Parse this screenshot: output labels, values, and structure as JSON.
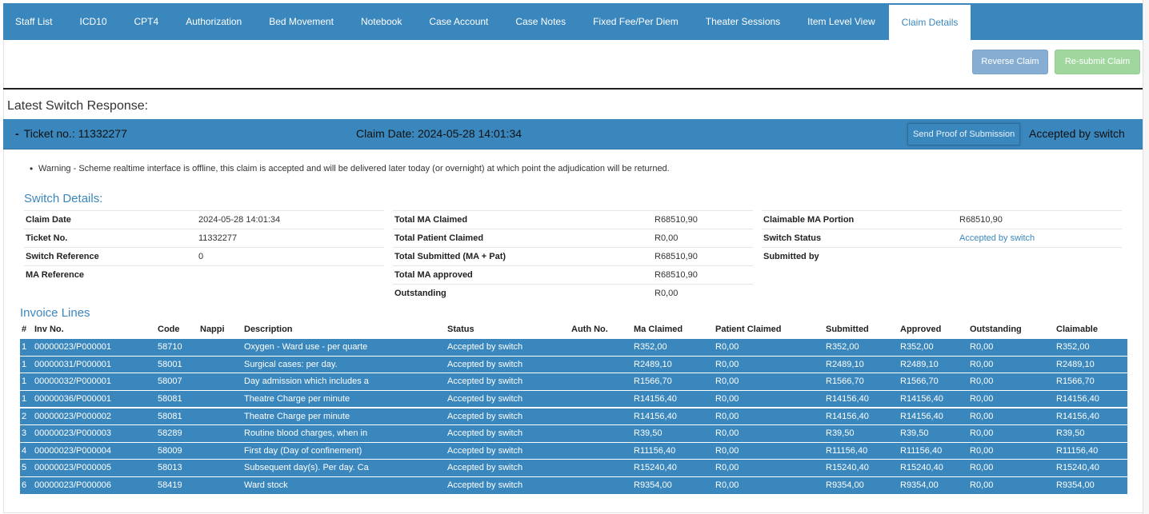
{
  "tabs": [
    {
      "label": "Staff List",
      "active": false
    },
    {
      "label": "ICD10",
      "active": false
    },
    {
      "label": "CPT4",
      "active": false
    },
    {
      "label": "Authorization",
      "active": false
    },
    {
      "label": "Bed Movement",
      "active": false
    },
    {
      "label": "Notebook",
      "active": false
    },
    {
      "label": "Case Account",
      "active": false
    },
    {
      "label": "Case Notes",
      "active": false
    },
    {
      "label": "Fixed Fee/Per Diem",
      "active": false
    },
    {
      "label": "Theater Sessions",
      "active": false
    },
    {
      "label": "Item Level View",
      "active": false
    },
    {
      "label": "Claim Details",
      "active": true
    }
  ],
  "actions": {
    "reverse_label": "Reverse Claim",
    "resubmit_label": "Re-submit Claim"
  },
  "latest": {
    "heading": "Latest Switch Response:",
    "collapse_symbol": "-",
    "ticket_label": "Ticket no.: 11332277",
    "claim_date_label": "Claim Date: 2024-05-28 14:01:34",
    "send_proof_label": "Send Proof of Submission",
    "status_text": "Accepted by switch",
    "warning": "Warning - Scheme realtime interface is offline, this claim is accepted and will be delivered later today (or overnight) at which point the adjudication will be returned."
  },
  "switch_details": {
    "title": "Switch Details:",
    "col1": [
      {
        "label": "Claim Date",
        "value": "2024-05-28 14:01:34"
      },
      {
        "label": "Ticket No.",
        "value": "11332277"
      },
      {
        "label": "Switch Reference",
        "value": "0"
      },
      {
        "label": "MA Reference",
        "value": ""
      }
    ],
    "col2": [
      {
        "label": "Total MA Claimed",
        "value": "R68510,90"
      },
      {
        "label": "Total Patient Claimed",
        "value": "R0,00"
      },
      {
        "label": "Total Submitted (MA + Pat)",
        "value": "R68510,90"
      },
      {
        "label": "Total MA approved",
        "value": "R68510,90"
      },
      {
        "label": "Outstanding",
        "value": "R0,00"
      }
    ],
    "col3": [
      {
        "label": "Claimable MA Portion",
        "value": "R68510,90"
      },
      {
        "label": "Switch Status",
        "value": "Accepted by switch"
      },
      {
        "label": "Submitted by",
        "value": ""
      }
    ]
  },
  "invoice": {
    "title": "Invoice Lines",
    "headers": [
      "#",
      "Inv No.",
      "Code",
      "Nappi",
      "Description",
      "Status",
      "Auth No.",
      "Ma Claimed",
      "Patient Claimed",
      "Submitted",
      "Approved",
      "Outstanding",
      "Claimable"
    ],
    "rows": [
      [
        "1",
        "00000023/P000001",
        "58710",
        "",
        "Oxygen - Ward use - per quarte",
        "Accepted by switch",
        "",
        "R352,00",
        "R0,00",
        "R352,00",
        "R352,00",
        "R0,00",
        "R352,00"
      ],
      [
        "1",
        "00000031/P000001",
        "58001",
        "",
        "Surgical cases: per day.",
        "Accepted by switch",
        "",
        "R2489,10",
        "R0,00",
        "R2489,10",
        "R2489,10",
        "R0,00",
        "R2489,10"
      ],
      [
        "1",
        "00000032/P000001",
        "58007",
        "",
        "Day admission which includes a",
        "Accepted by switch",
        "",
        "R1566,70",
        "R0,00",
        "R1566,70",
        "R1566,70",
        "R0,00",
        "R1566,70"
      ],
      [
        "1",
        "00000036/P000001",
        "58081",
        "",
        "Theatre Charge per minute",
        "Accepted by switch",
        "",
        "R14156,40",
        "R0,00",
        "R14156,40",
        "R14156,40",
        "R0,00",
        "R14156,40"
      ],
      [
        "2",
        "00000023/P000002",
        "58081",
        "",
        "Theatre Charge per minute",
        "Accepted by switch",
        "",
        "R14156,40",
        "R0,00",
        "R14156,40",
        "R14156,40",
        "R0,00",
        "R14156,40"
      ],
      [
        "3",
        "00000023/P000003",
        "58289",
        "",
        "Routine blood charges, when in",
        "Accepted by switch",
        "",
        "R39,50",
        "R0,00",
        "R39,50",
        "R39,50",
        "R0,00",
        "R39,50"
      ],
      [
        "4",
        "00000023/P000004",
        "58009",
        "",
        "First day (Day of confinement)",
        "Accepted by switch",
        "",
        "R11156,40",
        "R0,00",
        "R11156,40",
        "R11156,40",
        "R0,00",
        "R11156,40"
      ],
      [
        "5",
        "00000023/P000005",
        "58013",
        "",
        "Subsequent day(s). Per day. Ca",
        "Accepted by switch",
        "",
        "R15240,40",
        "R0,00",
        "R15240,40",
        "R15240,40",
        "R0,00",
        "R15240,40"
      ],
      [
        "6",
        "00000023/P000006",
        "58419",
        "",
        "Ward stock",
        "Accepted by switch",
        "",
        "R9354,00",
        "R0,00",
        "R9354,00",
        "R9354,00",
        "R0,00",
        "R9354,00"
      ]
    ]
  }
}
